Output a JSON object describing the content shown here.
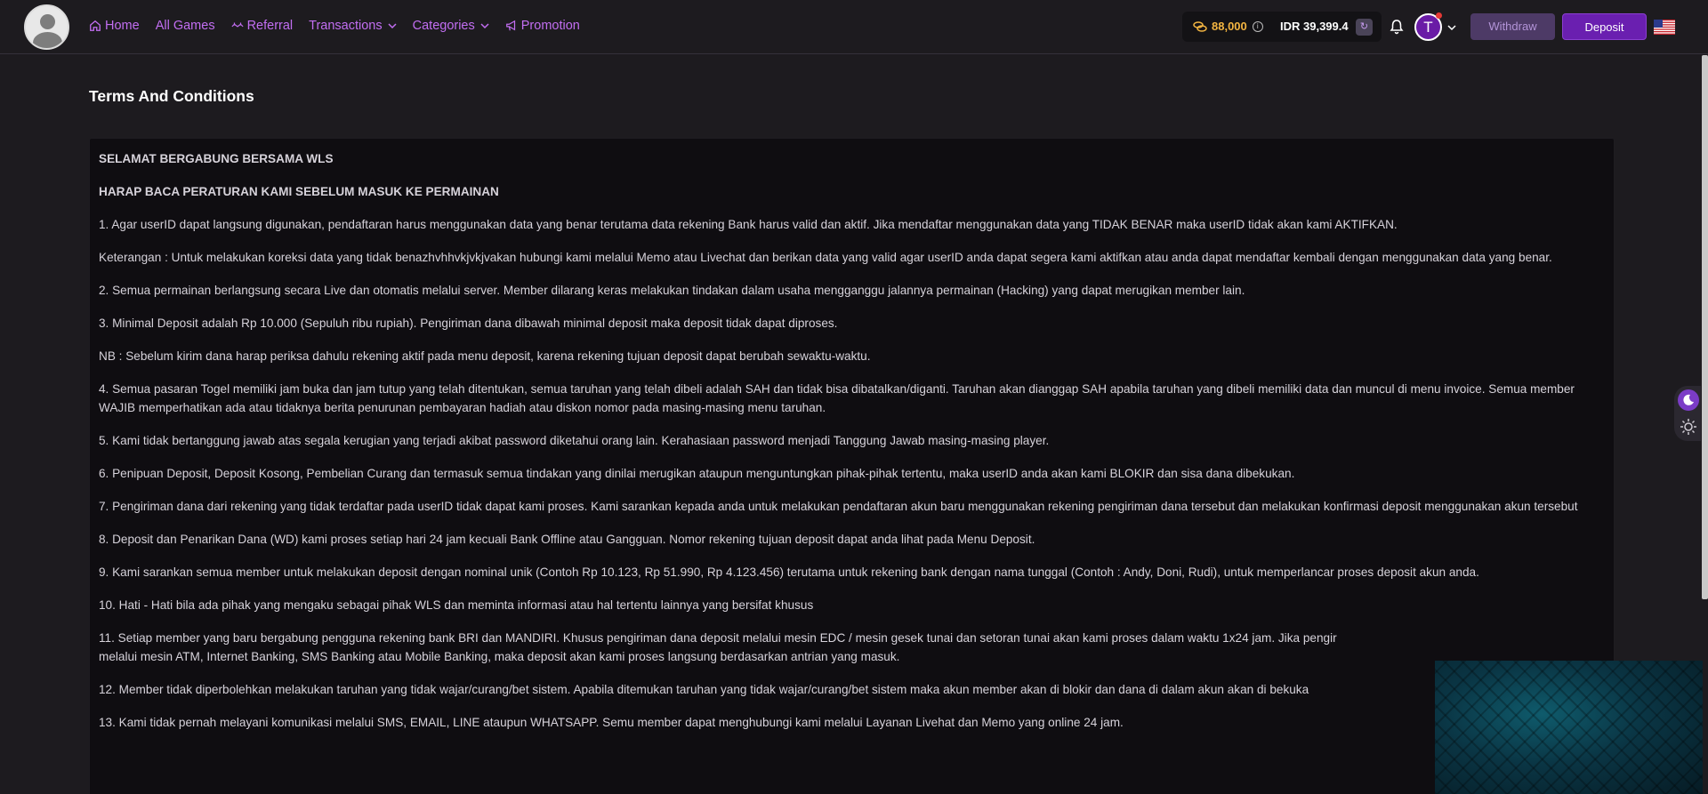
{
  "nav": {
    "items": [
      {
        "label": "Home",
        "icon": "home-icon"
      },
      {
        "label": "All Games"
      },
      {
        "label": "Referral",
        "icon": "referral-icon"
      },
      {
        "label": "Transactions",
        "dropdown": true
      },
      {
        "label": "Categories",
        "dropdown": true
      },
      {
        "label": "Promotion",
        "icon": "megaphone-icon"
      }
    ],
    "accent_color": "#c26ef2"
  },
  "wallet": {
    "coins": "88,000",
    "balance": "IDR 39,399.4"
  },
  "user": {
    "initial": "T"
  },
  "buttons": {
    "withdraw": "Withdraw",
    "deposit": "Deposit"
  },
  "page": {
    "title": "Terms And Conditions"
  },
  "terms": [
    "SELAMAT BERGABUNG BERSAMA WLS",
    "HARAP BACA PERATURAN KAMI SEBELUM MASUK KE PERMAINAN",
    "1. Agar userID dapat langsung digunakan, pendaftaran harus menggunakan data yang benar terutama data rekening Bank harus valid dan aktif. Jika mendaftar menggunakan data yang TIDAK BENAR maka userID tidak akan kami AKTIFKAN.",
    "Keterangan : Untuk melakukan koreksi data yang tidak benazhvhhvkjvkjvakan hubungi kami melalui Memo atau Livechat dan berikan data yang valid agar userID anda dapat segera kami aktifkan atau anda dapat mendaftar kembali dengan menggunakan data yang benar.",
    "2. Semua permainan berlangsung secara Live dan otomatis melalui server. Member dilarang keras melakukan tindakan dalam usaha mengganggu jalannya permainan (Hacking) yang dapat merugikan member lain.",
    "3. Minimal Deposit adalah Rp 10.000 (Sepuluh ribu rupiah). Pengiriman dana dibawah minimal deposit maka deposit tidak dapat diproses.",
    "NB : Sebelum kirim dana harap periksa dahulu rekening aktif pada menu deposit, karena rekening tujuan deposit dapat berubah sewaktu-waktu.",
    "4. Semua pasaran Togel memiliki jam buka dan jam tutup yang telah ditentukan, semua taruhan yang telah dibeli adalah SAH dan tidak bisa dibatalkan/diganti. Taruhan akan dianggap SAH apabila taruhan yang dibeli memiliki data dan muncul di menu invoice. Semua member WAJIB memperhatikan ada atau tidaknya berita penurunan pembayaran hadiah atau diskon nomor pada masing-masing menu taruhan.",
    "5. Kami tidak bertanggung jawab atas segala kerugian yang terjadi akibat password diketahui orang lain. Kerahasiaan password menjadi Tanggung Jawab masing-masing player.",
    "6. Penipuan Deposit, Deposit Kosong, Pembelian Curang dan termasuk semua tindakan yang dinilai merugikan ataupun menguntungkan pihak-pihak tertentu, maka userID anda akan kami BLOKIR dan sisa dana dibekukan.",
    "7. Pengiriman dana dari rekening yang tidak terdaftar pada userID tidak dapat kami proses. Kami sarankan kepada anda untuk melakukan pendaftaran akun baru menggunakan rekening pengiriman dana tersebut dan melakukan konfirmasi deposit menggunakan akun tersebut",
    "8. Deposit dan Penarikan Dana (WD) kami proses setiap hari 24 jam kecuali Bank Offline atau Gangguan. Nomor rekening tujuan deposit dapat anda lihat pada Menu Deposit.",
    "9. Kami sarankan semua member untuk melakukan deposit dengan nominal unik (Contoh Rp 10.123, Rp 51.990, Rp 4.123.456) terutama untuk rekening bank dengan nama tunggal (Contoh : Andy, Doni, Rudi), untuk memperlancar proses deposit akun anda.",
    "10. Hati - Hati bila ada pihak yang mengaku sebagai pihak WLS dan meminta informasi atau hal tertentu lainnya yang bersifat khusus",
    "11. Setiap member yang baru bergabung pengguna rekening bank BRI dan MANDIRI. Khusus pengiriman dana deposit melalui mesin EDC / mesin gesek tunai dan setoran tunai akan kami proses dalam waktu 1x24 jam. Jika pengir",
    "melalui mesin ATM, Internet Banking, SMS Banking atau Mobile Banking, maka deposit akan kami proses langsung berdasarkan antrian yang masuk.",
    "12. Member tidak diperbolehkan melakukan taruhan yang tidak wajar/curang/bet sistem. Apabila ditemukan taruhan yang tidak wajar/curang/bet sistem maka akun member akan di blokir dan dana di dalam akun akan di bekuka",
    "13. Kami tidak pernah melayani komunikasi melalui SMS, EMAIL, LINE ataupun WHATSAPP. Semu member dapat menghubungi kami melalui Layanan Livehat dan Memo yang online 24 jam."
  ]
}
